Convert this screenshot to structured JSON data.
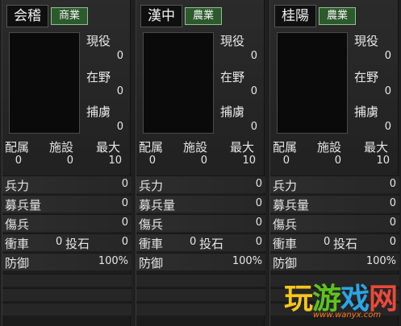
{
  "labels": {
    "active": "現役",
    "unaffiliated": "在野",
    "captive": "捕虜",
    "assigned": "配属",
    "facilities": "施設",
    "max": "最大",
    "troops": "兵力",
    "recruits": "募兵量",
    "wounded": "傷兵",
    "ram": "衝車",
    "catapult": "投石",
    "defense": "防御"
  },
  "cities": [
    {
      "name": "会稽",
      "industry": "商業",
      "active": "0",
      "unaffiliated": "0",
      "captive": "0",
      "assigned": "0",
      "facilities": "0",
      "max": "10",
      "troops": "0",
      "recruits": "0",
      "wounded": "0",
      "ram": "0",
      "catapult": "0",
      "defense": "100%"
    },
    {
      "name": "漢中",
      "industry": "農業",
      "active": "0",
      "unaffiliated": "0",
      "captive": "0",
      "assigned": "0",
      "facilities": "0",
      "max": "10",
      "troops": "0",
      "recruits": "0",
      "wounded": "0",
      "ram": "0",
      "catapult": "0",
      "defense": "100%"
    },
    {
      "name": "桂陽",
      "industry": "農業",
      "active": "0",
      "unaffiliated": "0",
      "captive": "0",
      "assigned": "0",
      "facilities": "0",
      "max": "10",
      "troops": "0",
      "recruits": "0",
      "wounded": "0",
      "ram": "0",
      "catapult": "0",
      "defense": "100%"
    }
  ],
  "watermark": {
    "chars": [
      "玩",
      "游",
      "戏",
      "网"
    ],
    "url": "www.wanyx.com",
    "colors": [
      "#f6c61b",
      "#5fc31e",
      "#2ba5e6",
      "#e94a3b"
    ]
  }
}
